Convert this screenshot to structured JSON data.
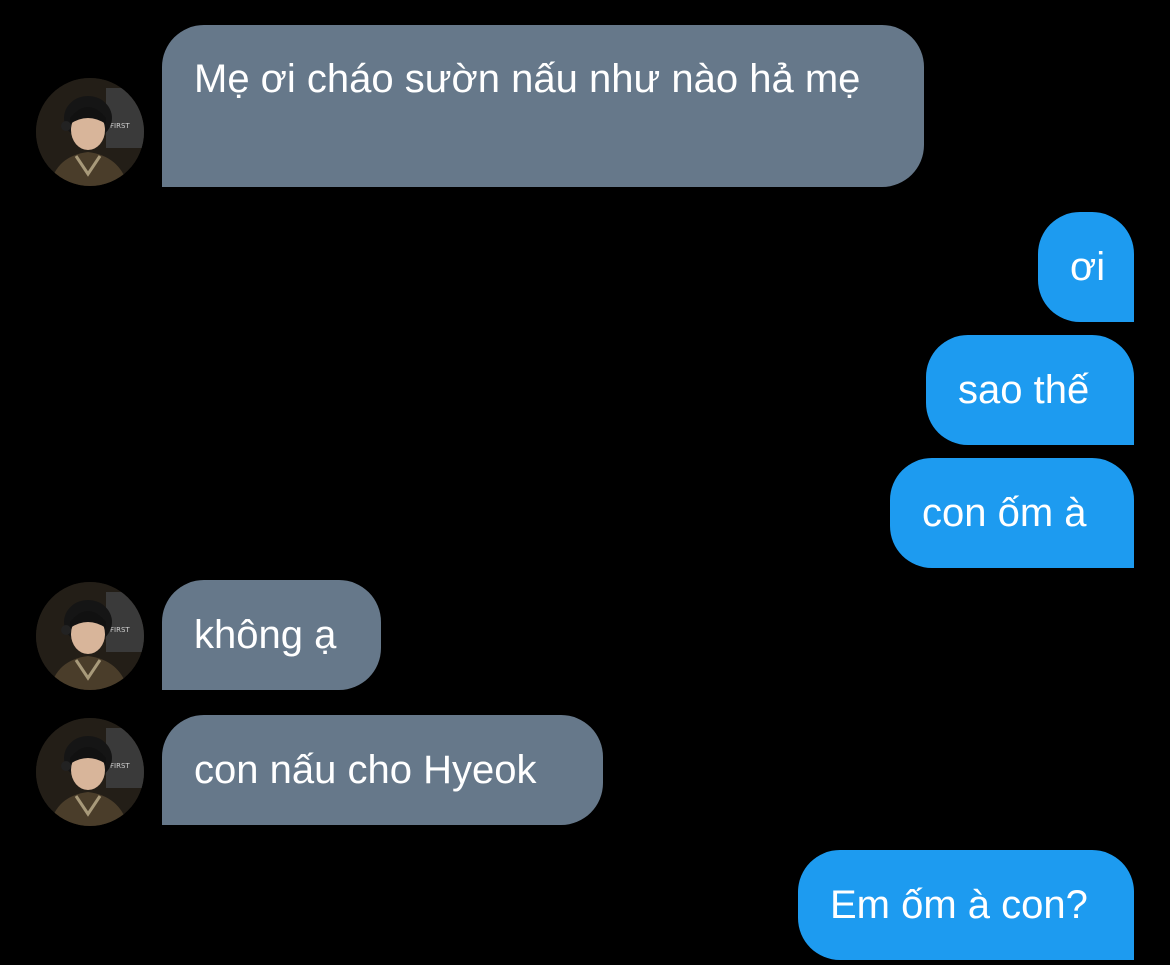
{
  "conversation": {
    "messages": [
      {
        "from": "them",
        "text": "Mẹ ơi cháo sườn nấu như nào hả mẹ"
      },
      {
        "from": "me",
        "text": "ơi"
      },
      {
        "from": "me",
        "text": "sao thế"
      },
      {
        "from": "me",
        "text": "con ốm à"
      },
      {
        "from": "them",
        "text": "không ạ"
      },
      {
        "from": "them",
        "text": "con nấu cho Hyeok"
      },
      {
        "from": "me",
        "text": "Em ốm à con?"
      }
    ]
  },
  "colors": {
    "background": "#000000",
    "incoming_bubble": "#66788a",
    "outgoing_bubble": "#1d9bf0",
    "bubble_text": "#ffffff"
  },
  "icons": {
    "avatar": "avatar-photo"
  }
}
